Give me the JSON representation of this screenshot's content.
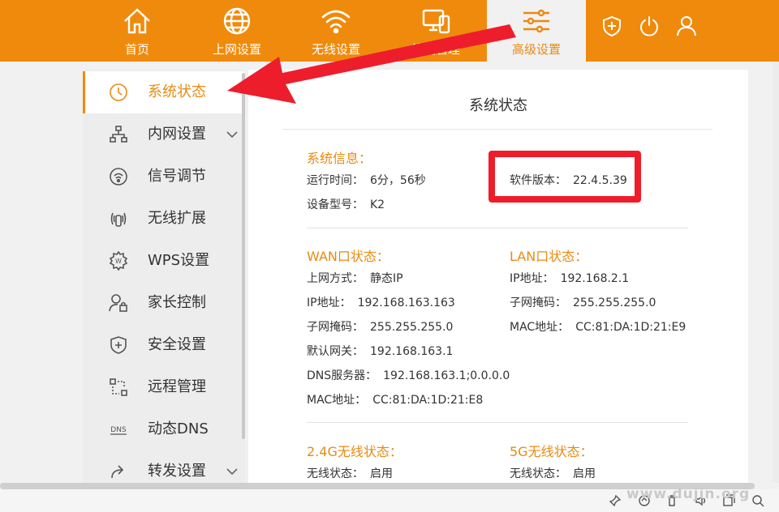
{
  "nav": {
    "items": [
      {
        "label": "首页",
        "icon": "home-icon"
      },
      {
        "label": "上网设置",
        "icon": "globe-icon"
      },
      {
        "label": "无线设置",
        "icon": "wifi-icon"
      },
      {
        "label": "终端管理",
        "icon": "devices-icon"
      },
      {
        "label": "高级设置",
        "icon": "sliders-icon"
      }
    ],
    "active": "高级设置",
    "right_icons": [
      "shield-plus-icon",
      "power-icon",
      "user-icon"
    ]
  },
  "sidebar": {
    "items": [
      {
        "label": "系统状态",
        "icon": "clock-icon"
      },
      {
        "label": "内网设置",
        "icon": "network-icon"
      },
      {
        "label": "信号调节",
        "icon": "signal-icon"
      },
      {
        "label": "无线扩展",
        "icon": "wireless-extend-icon"
      },
      {
        "label": "WPS设置",
        "icon": "wps-gear-icon"
      },
      {
        "label": "家长控制",
        "icon": "parent-lock-icon"
      },
      {
        "label": "安全设置",
        "icon": "shield-icon"
      },
      {
        "label": "远程管理",
        "icon": "remote-icon"
      },
      {
        "label": "动态DNS",
        "icon": "dns-icon"
      },
      {
        "label": "转发设置",
        "icon": "forward-icon"
      }
    ],
    "active": "系统状态"
  },
  "main": {
    "title": "系统状态",
    "system_info": {
      "title": "系统信息：",
      "uptime_label": "运行时间：",
      "uptime_value": "6分，56秒",
      "model_label": "设备型号：",
      "model_value": "K2",
      "software_label": "软件版本：",
      "software_value": "22.4.5.39"
    },
    "wan": {
      "title": "WAN口状态：",
      "rows": [
        {
          "k": "上网方式：",
          "v": "静态IP"
        },
        {
          "k": "IP地址：",
          "v": "192.168.163.163"
        },
        {
          "k": "子网掩码：",
          "v": "255.255.255.0"
        },
        {
          "k": "默认网关：",
          "v": "192.168.163.1"
        },
        {
          "k": "DNS服务器：",
          "v": "192.168.163.1;0.0.0.0"
        },
        {
          "k": "MAC地址：",
          "v": "CC:81:DA:1D:21:E8"
        }
      ]
    },
    "lan": {
      "title": "LAN口状态：",
      "rows": [
        {
          "k": "IP地址：",
          "v": "192.168.2.1"
        },
        {
          "k": "子网掩码：",
          "v": "255.255.255.0"
        },
        {
          "k": "MAC地址：",
          "v": "CC:81:DA:1D:21:E9"
        }
      ]
    },
    "wifi24": {
      "title": "2.4G无线状态：",
      "status_label": "无线状态：",
      "status_value": "启用"
    },
    "wifi5": {
      "title": "5G无线状态：",
      "status_label": "无线状态：",
      "status_value": "启用"
    }
  },
  "watermark": "www.dujin.org",
  "colors": {
    "accent": "#f08a0c",
    "highlight": "#ef1c2a",
    "arrow": "#ee1d2c"
  }
}
